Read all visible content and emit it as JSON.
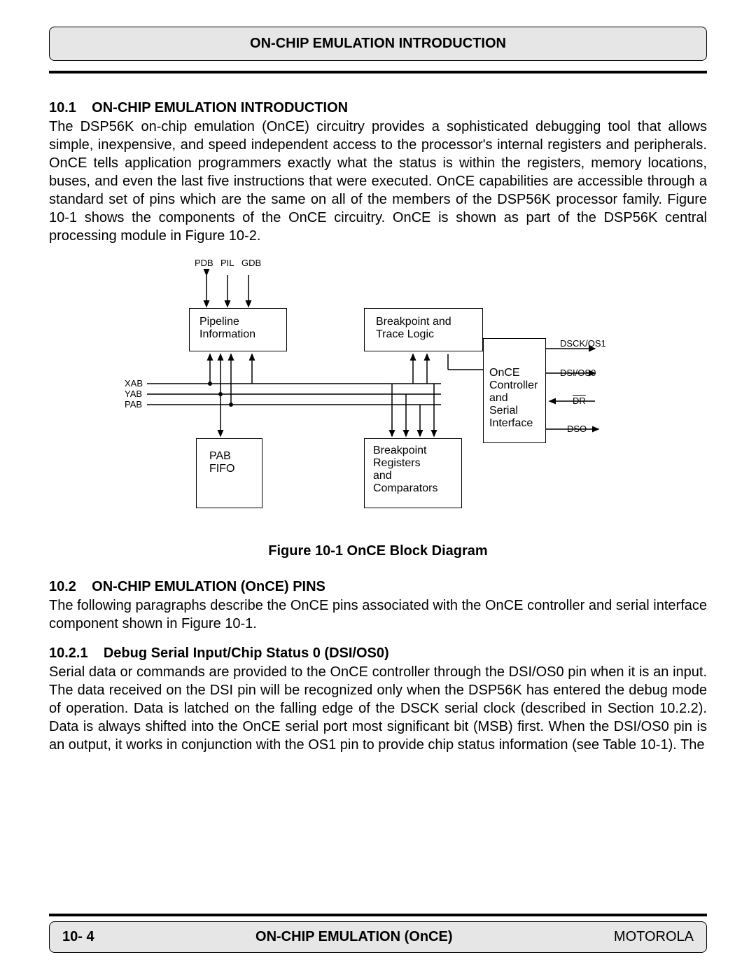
{
  "header": {
    "title": "ON-CHIP EMULATION INTRODUCTION"
  },
  "sections": {
    "s1": {
      "num": "10.1",
      "title": "ON-CHIP EMULATION INTRODUCTION",
      "para": "The DSP56K on-chip emulation (OnCE) circuitry provides a sophisticated debugging tool that allows simple, inexpensive, and speed independent access to the processor's internal registers and peripherals. OnCE tells application programmers exactly what the status is within the registers, memory locations, buses, and even the last five instructions that were executed. OnCE capabilities are accessible through a standard set of pins which are the same on all of the members of the DSP56K processor family. Figure 10-1 shows the components of the OnCE circuitry. OnCE is shown as part of the DSP56K central processing module in Figure 10-2."
    },
    "figure": {
      "caption": "Figure  10-1 OnCE Block Diagram",
      "top_labels": {
        "pdb": "PDB",
        "pil": "PIL",
        "gdb": "GDB"
      },
      "left_labels": {
        "xab": "XAB",
        "yab": "YAB",
        "pab": "PAB"
      },
      "boxes": {
        "pipeline_l1": "Pipeline",
        "pipeline_l2": "Information",
        "bpt_logic_l1": "Breakpoint and",
        "bpt_logic_l2": "Trace Logic",
        "pab_fifo_l1": "PAB",
        "pab_fifo_l2": "FIFO",
        "bpt_reg_l1": "Breakpoint",
        "bpt_reg_l2": "Registers",
        "bpt_reg_l3": "and",
        "bpt_reg_l4": "Comparators",
        "once_l1": "OnCE",
        "once_l2": "Controller",
        "once_l3": "and",
        "once_l4": "Serial",
        "once_l5": "Interface"
      },
      "pins": {
        "dsck": "DSCK/OS1",
        "dsi": "DSI/OS0",
        "dr": "DR",
        "dso": "DSO"
      }
    },
    "s2": {
      "num": "10.2",
      "title": "ON-CHIP EMULATION (OnCE) PINS",
      "para": "The following paragraphs describe the OnCE pins associated with the OnCE controller and serial interface component shown in Figure 10-1."
    },
    "s21": {
      "num": "10.2.1",
      "title": "Debug Serial Input/Chip Status 0 (DSI/OS0)",
      "para": "Serial data or commands are provided to the OnCE controller through the DSI/OS0 pin when it is an input. The data received on the DSI pin will be recognized only when the DSP56K has entered the debug mode of operation. Data is latched on the falling edge of the DSCK serial clock (described in Section 10.2.2). Data is always shifted into the OnCE serial port most significant bit (MSB) first. When the DSI/OS0 pin is an output, it works in conjunction with the OS1 pin to provide chip status information (see Table 10-1). The"
    }
  },
  "footer": {
    "left": "10- 4",
    "center": "ON-CHIP EMULATION (OnCE)",
    "right": "MOTOROLA"
  }
}
